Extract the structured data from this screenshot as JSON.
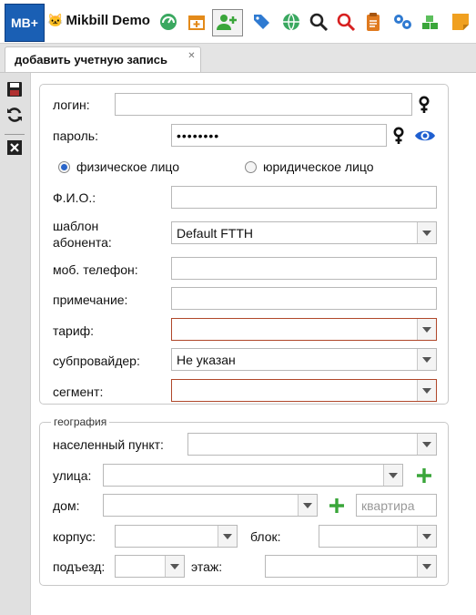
{
  "app": {
    "logo_text": "MB+",
    "brand": "Mikbill Demo",
    "toolbar_icons": [
      "dashboard-icon",
      "calendar-add-icon",
      "add-user-icon",
      "tags-icon",
      "globe-icon",
      "search-icon",
      "search-red-icon",
      "clipboard-icon",
      "settings-icon",
      "stack-icon",
      "sticky-note-icon"
    ]
  },
  "tab": {
    "label": "добавить учетную запись",
    "close": "✕"
  },
  "side_buttons": [
    "save-icon",
    "refresh-icon",
    "close-icon"
  ],
  "form": {
    "login_label": "логин:",
    "login_value": "",
    "password_label": "пароль:",
    "password_value": "••••••••",
    "radio_individual": "физическое лицо",
    "radio_company": "юридическое лицо",
    "fio_label": "Ф.И.О.:",
    "template_label_1": "шаблон",
    "template_label_2": "абонента:",
    "template_value": "Default FTTH",
    "phone_label": "моб. телефон:",
    "note_label": "примечание:",
    "tariff_label": "тариф:",
    "tariff_value": "",
    "subprovider_label": "субпровайдер:",
    "subprovider_value": "Не указан",
    "segment_label": "сегмент:",
    "segment_value": ""
  },
  "geo": {
    "legend": "география",
    "city_label": "населенный пункт:",
    "street_label": "улица:",
    "house_label": "дом:",
    "apartment_placeholder": "квартира",
    "building_label": "корпус:",
    "block_label": "блок:",
    "entrance_label": "подъезд:",
    "floor_label": "этаж:"
  },
  "colors": {
    "accent": "#1a5fb4",
    "invalid_border": "#b0472a",
    "add_green": "#3aa63a"
  }
}
